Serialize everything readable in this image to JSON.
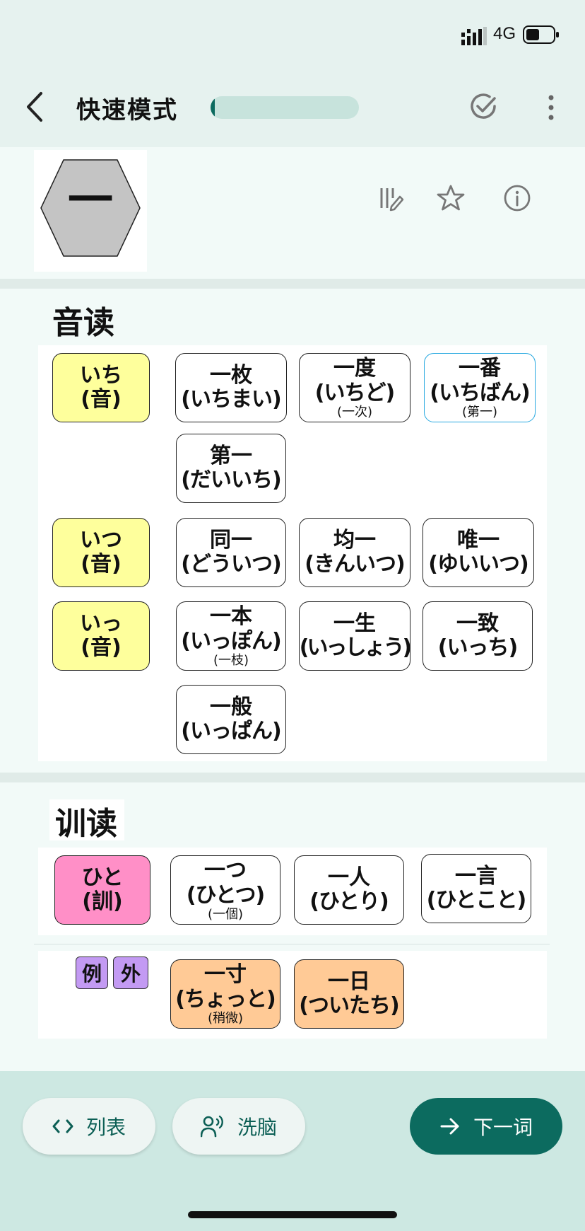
{
  "status_bar": {
    "network": "4G",
    "battery_level": 0.5
  },
  "header": {
    "back_icon": "chevron-left-icon",
    "title": "快速模式",
    "progress": 0.03,
    "check_icon": "check-circle-icon",
    "more_icon": "more-vertical-icon"
  },
  "kanji": {
    "character": "一",
    "tools": [
      "edit-list-icon",
      "star-icon",
      "info-icon"
    ]
  },
  "onyomi": {
    "label": "音读",
    "groups": [
      {
        "reading": "いち",
        "tag": "(音)",
        "words": [
          {
            "word": "一枚",
            "reading": "(いちまい)",
            "note": ""
          },
          {
            "word": "一度",
            "reading": "(いちど)",
            "note": "(一次)"
          },
          {
            "word": "一番",
            "reading": "(いちばん)",
            "note": "(第一)"
          },
          {
            "word": "第一",
            "reading": "(だいいち)",
            "note": ""
          }
        ]
      },
      {
        "reading": "いつ",
        "tag": "(音)",
        "words": [
          {
            "word": "同一",
            "reading": "(どういつ)",
            "note": ""
          },
          {
            "word": "均一",
            "reading": "(きんいつ)",
            "note": ""
          },
          {
            "word": "唯一",
            "reading": "(ゆいいつ)",
            "note": ""
          }
        ]
      },
      {
        "reading": "いっ",
        "tag": "(音)",
        "words": [
          {
            "word": "一本",
            "reading": "(いっぽん)",
            "note": "(一枝)"
          },
          {
            "word": "一生",
            "reading": "(いっしょう)",
            "note": ""
          },
          {
            "word": "一致",
            "reading": "(いっち)",
            "note": ""
          },
          {
            "word": "一般",
            "reading": "(いっぱん)",
            "note": ""
          }
        ]
      }
    ]
  },
  "kunyomi": {
    "label": "训读",
    "reading": "ひと",
    "tag": "(訓)",
    "words": [
      {
        "word": "一つ",
        "reading": "(ひとつ)",
        "note": "(一個)"
      },
      {
        "word": "一人",
        "reading": "(ひとり)",
        "note": ""
      },
      {
        "word": "一言",
        "reading": "(ひとこと)",
        "note": ""
      }
    ],
    "exception_label": [
      "例",
      "外"
    ],
    "exceptions": [
      {
        "word": "一寸",
        "reading": "(ちょっと)",
        "note": "(稍微)"
      },
      {
        "word": "一日",
        "reading": "(ついたち)",
        "note": ""
      }
    ]
  },
  "bottom_bar": {
    "list_label": "列表",
    "list_icon": "code-brackets-icon",
    "brainwash_label": "洗脑",
    "brainwash_icon": "speaking-person-icon",
    "next_label": "下一词",
    "next_icon": "arrow-right-icon"
  }
}
